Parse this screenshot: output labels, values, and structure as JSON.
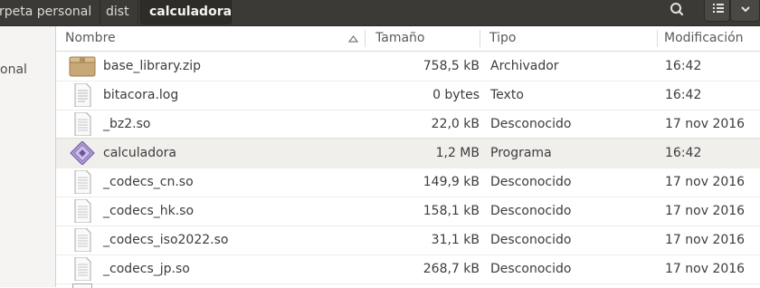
{
  "toolbar": {
    "breadcrumbs": [
      "rpeta personal",
      "dist",
      "calculadora"
    ]
  },
  "sidebar": {
    "items": [
      {
        "label": "onal"
      }
    ]
  },
  "columns": {
    "name": "Nombre",
    "size": "Tamaño",
    "type": "Tipo",
    "modified": "Modificación"
  },
  "files": [
    {
      "name": "base_library.zip",
      "size": "758,5 kB",
      "type": "Archivador",
      "modified": "16:42",
      "icon": "archive-icon"
    },
    {
      "name": "bitacora.log",
      "size": "0 bytes",
      "type": "Texto",
      "modified": "16:42",
      "icon": "text-file-icon"
    },
    {
      "name": "_bz2.so",
      "size": "22,0 kB",
      "type": "Desconocido",
      "modified": "17 nov 2016",
      "icon": "generic-file-icon"
    },
    {
      "name": "calculadora",
      "size": "1,2 MB",
      "type": "Programa",
      "modified": "16:42",
      "icon": "executable-icon"
    },
    {
      "name": "_codecs_cn.so",
      "size": "149,9 kB",
      "type": "Desconocido",
      "modified": "17 nov 2016",
      "icon": "generic-file-icon"
    },
    {
      "name": "_codecs_hk.so",
      "size": "158,1 kB",
      "type": "Desconocido",
      "modified": "17 nov 2016",
      "icon": "generic-file-icon"
    },
    {
      "name": "_codecs_iso2022.so",
      "size": "31,1 kB",
      "type": "Desconocido",
      "modified": "17 nov 2016",
      "icon": "generic-file-icon"
    },
    {
      "name": "_codecs_jp.so",
      "size": "268,7 kB",
      "type": "Desconocido",
      "modified": "17 nov 2016",
      "icon": "generic-file-icon"
    }
  ],
  "colors": {
    "toolbar_bg": "#3b3a37",
    "selected_row": "#f0efec",
    "folder_active": "#2d2c29"
  }
}
